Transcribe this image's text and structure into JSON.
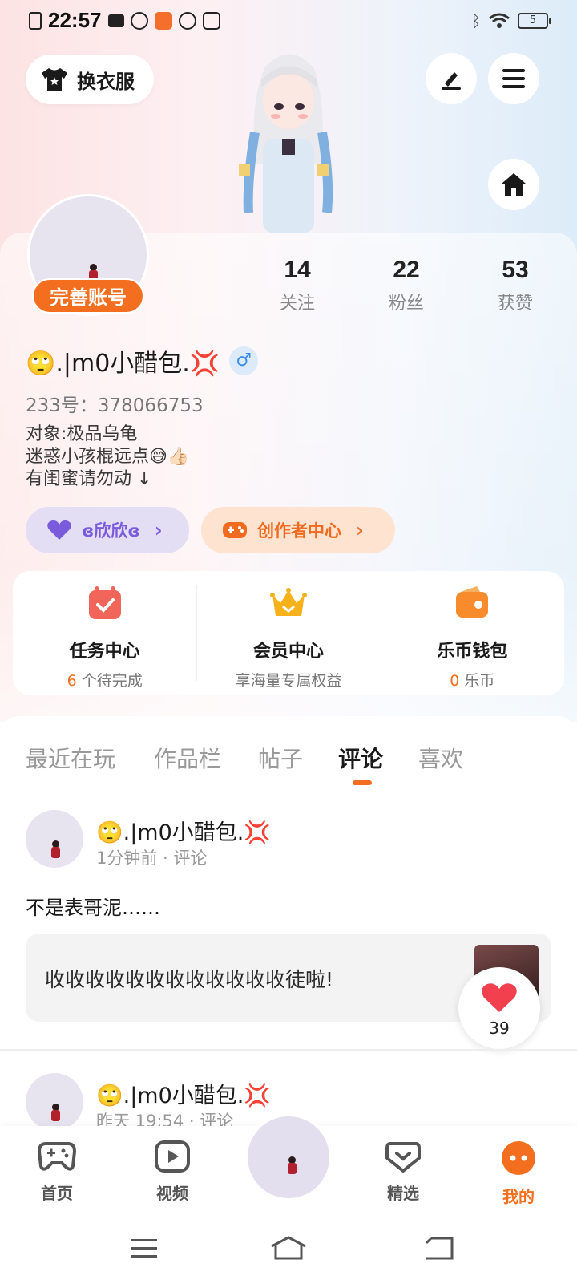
{
  "status_bar": {
    "time": "22:57",
    "battery": "5"
  },
  "top_actions": {
    "dress_label": "换衣服"
  },
  "profile": {
    "complete_label": "完善账号",
    "stats": [
      {
        "value": "14",
        "label": "关注"
      },
      {
        "value": "22",
        "label": "粉丝"
      },
      {
        "value": "53",
        "label": "获赞"
      }
    ],
    "username": "🙄.|m0小醋包.💢",
    "gender_symbol": "♂",
    "account_id": "233号：378066753",
    "bio_lines": [
      "对象:极品乌龟",
      "迷惑小孩棍远点😅👍🏻",
      "有闺蜜请勿动 ↓"
    ],
    "guild_label": "ɞ欣欣ɞ",
    "creator_label": "创作者中心"
  },
  "services": [
    {
      "title": "任务中心",
      "sub_accent": "6",
      "sub": " 个待完成"
    },
    {
      "title": "会员中心",
      "sub_accent": "",
      "sub": "享海量专属权益"
    },
    {
      "title": "乐币钱包",
      "sub_accent": "0",
      "sub": " 乐币"
    }
  ],
  "tabs": [
    "最近在玩",
    "作品栏",
    "帖子",
    "评论",
    "喜欢"
  ],
  "active_tab": "评论",
  "comments": [
    {
      "user": "🙄.|m0小醋包.💢",
      "meta": "1分钟前  ·  评论",
      "text": "不是表哥泥……",
      "quote": "收收收收收收收收收收收收徒啦!",
      "likes": "39"
    },
    {
      "user": "🙄.|m0小醋包.💢",
      "meta": "昨天 19:54  ·  评论"
    }
  ],
  "bottom_nav": [
    {
      "label": "首页",
      "icon": "gamepad-icon"
    },
    {
      "label": "视频",
      "icon": "video-icon"
    },
    {
      "label": "精选",
      "icon": "heart-chat-icon"
    },
    {
      "label": "我的",
      "icon": "profile-dots-icon"
    }
  ],
  "colors": {
    "accent": "#f36f1f",
    "purple": "#7a5bdc"
  }
}
